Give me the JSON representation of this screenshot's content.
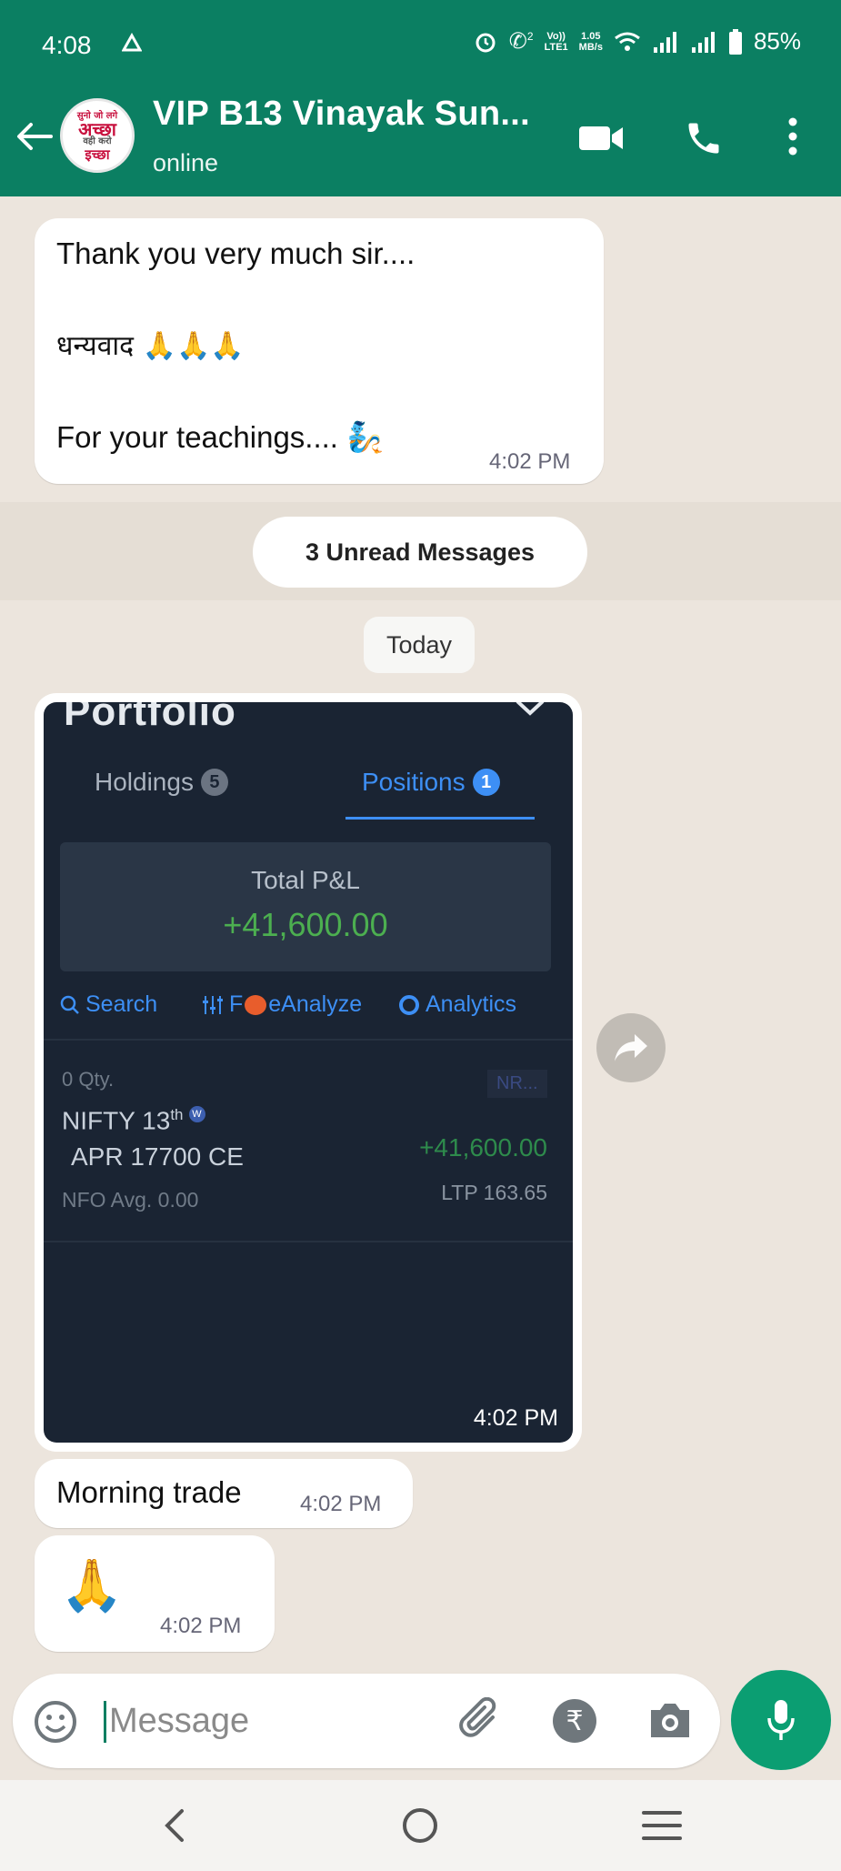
{
  "status_bar": {
    "time": "4:08",
    "net_speed_top": "1.05",
    "net_speed_bottom": "MB/s",
    "volte_top": "Vo))",
    "volte_bottom": "LTE1",
    "sim_badge": "2",
    "battery": "85%"
  },
  "header": {
    "contact_name": "VIP B13 Vinayak Sun...",
    "status": "online",
    "avatar_text": [
      "सुनो जो लगे",
      "अच्छा",
      "वही करो",
      "इच्छा"
    ],
    "theme_color": "#0b7f62"
  },
  "chat": {
    "messages": [
      {
        "line1": "Thank you very much sir....",
        "line2": "धन्यवाद 🙏🙏🙏",
        "line3": "For your teachings.... 🧞",
        "time": "4:02 PM"
      },
      {
        "text": "Morning trade",
        "time": "4:02 PM"
      },
      {
        "text": "🙏",
        "time": "4:02 PM"
      }
    ],
    "unread_label": "3 Unread Messages",
    "date_label": "Today",
    "image_message": {
      "time": "4:02 PM",
      "screenshot": {
        "title": "Portfolio",
        "tabs": [
          {
            "label": "Holdings",
            "count": "5"
          },
          {
            "label": "Positions",
            "count": "1"
          }
        ],
        "total_pl_label": "Total P&L",
        "total_pl_value": "+41,600.00",
        "tools": [
          "Search",
          "F",
          "eAnalyze",
          "Analytics"
        ],
        "position": {
          "qty": "0 Qty.",
          "badge": "NR...",
          "name_line1": "NIFTY 13",
          "name_sup": "th",
          "weekly_badge": "W",
          "name_line2": "APR 17700 CE",
          "pnl": "+41,600.00",
          "exchange_avg": "NFO  Avg. 0.00",
          "ltp": "LTP 163.65"
        }
      }
    }
  },
  "input_bar": {
    "placeholder": "Message",
    "currency_symbol": "₹"
  },
  "colors": {
    "header_green": "#0b7f62",
    "mic_green": "#0b9e72",
    "profit_green": "#4caf50",
    "link_blue": "#3d8ff5"
  }
}
